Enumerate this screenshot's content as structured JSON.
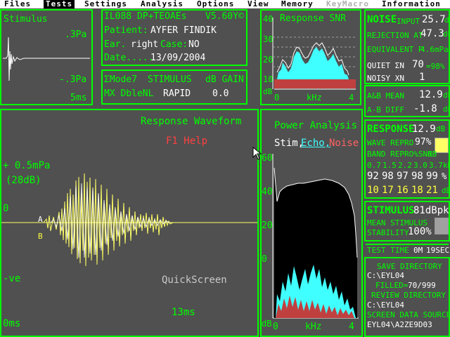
{
  "menu": {
    "items": [
      {
        "label": "Files"
      },
      {
        "label": "Tests"
      },
      {
        "label": "Settings"
      },
      {
        "label": "Analysis"
      },
      {
        "label": "Options"
      },
      {
        "label": "View"
      },
      {
        "label": "Memory"
      },
      {
        "label": "KeyMacro"
      },
      {
        "label": "Information"
      }
    ],
    "active": "Tests",
    "disabled": "KeyMacro"
  },
  "stimulus": {
    "title": "Stimulus",
    "top_scale": ".3Pa",
    "bottom_scale": "-.3Pa",
    "time": "5ms"
  },
  "info": {
    "device": "IL088 DP+TEOAEs",
    "version": "V5.60Y©",
    "patient_label": "Patient:",
    "patient_name": "AYFER FINDIK",
    "ear_label": "Ear.",
    "ear_value": "right",
    "case_label": "Case:",
    "case_value": "NO",
    "date_label": "Date.....",
    "date_value": "13/09/2004"
  },
  "mode": {
    "mode_label": "ΣMode7",
    "stimulus_label": "STIMULUS",
    "gain_label": "dB GAIN",
    "mode_value": "MX DbleNL",
    "stimulus_value": "RAPID",
    "gain_value": "0.0"
  },
  "snr": {
    "title": "Response SNR",
    "y_ticks": [
      "40",
      "30",
      "20",
      "10"
    ],
    "y_unit": "dB",
    "x_start": "0",
    "x_label": "kHz",
    "x_end": "4"
  },
  "noise": {
    "title": "NOISE",
    "input_label": "INPUT",
    "input_value": "25.7",
    "input_unit": "dB",
    "rejection_label": "REJECTION AT",
    "rejection_value": "47.3",
    "rejection_unit": "dB",
    "equivalent_label": "EQUIVALENT P",
    "equivalent_value": "4.6mPa",
    "quiet_label": "QUIET ΣN",
    "quiet_value": "70",
    "quiet_pct": "=98%",
    "noisy_label": "NOISY XN",
    "noisy_value": "1"
  },
  "ab": {
    "mean_label": "A&B MEAN",
    "mean_value": "12.9",
    "mean_unit": "dB",
    "diff_label": "A-B DIFF",
    "diff_value": "-1.8",
    "diff_unit": "dB"
  },
  "response_panel": {
    "title": "RESPONSE",
    "value": "12.9",
    "unit": "dB",
    "wave_repro_label": "WAVE REPRO",
    "wave_repro_value": "97%",
    "band_label": "BAND REPRO%SNR",
    "band_unit": "dB",
    "freqs": [
      "0.7",
      "1.5",
      "2.2",
      "3.0",
      "3.7"
    ],
    "freq_unit": "kHz",
    "repro": [
      "92",
      "98",
      "97",
      "98",
      "99"
    ],
    "repro_unit": "%",
    "snr": [
      "10",
      "17",
      "16",
      "18",
      "21"
    ],
    "snr_unit": "dB",
    "swatch_color": "#ffff66"
  },
  "stimulus_panel": {
    "title": "STIMULUS",
    "value": "81dBpk",
    "mean_label": "MEAN STIMULUS",
    "stability_label": "STABILITY",
    "stability_value": "100%",
    "swatch_color": "#a0a0a0"
  },
  "test_time": {
    "label": "TEST TIME",
    "minutes": "0M",
    "seconds": "19SEC"
  },
  "directory": {
    "save_label": "SAVE DIRECTORY",
    "save_path": "C:\\EYL04",
    "filled_label": "FILLED=",
    "filled_value": "70/999",
    "review_label": "REVIEW DIRECTORY",
    "review_path": "C:\\EYL04",
    "source_label": "SCREEN DATA SOURCE",
    "source_value": "EYL04\\A2ZE9D03"
  },
  "waveform": {
    "title": "Response Waveform",
    "help": "F1 Help",
    "top_scale": "+ 0.5mPa",
    "top_db": "(28dB)",
    "zero": "0",
    "bottom": "-ve",
    "time_start": "0ms",
    "time_end": "13ms",
    "mode_label": "QuickScreen",
    "marker_a": "A",
    "marker_b": "B"
  },
  "power": {
    "title": "Power Analysis",
    "legend_stim": "Stim,",
    "legend_echo": "Echo,",
    "legend_noise": "Noise",
    "y_ticks": [
      "60",
      "40",
      "20",
      "0"
    ],
    "y_unit": "dB",
    "x_start": "0",
    "x_label": "kHz",
    "x_end": "4"
  },
  "colors": {
    "background": "#505050",
    "frame": "#00ff00",
    "echo": "#40ffff",
    "noise": "#c04040",
    "waveform": "#ffff66"
  }
}
